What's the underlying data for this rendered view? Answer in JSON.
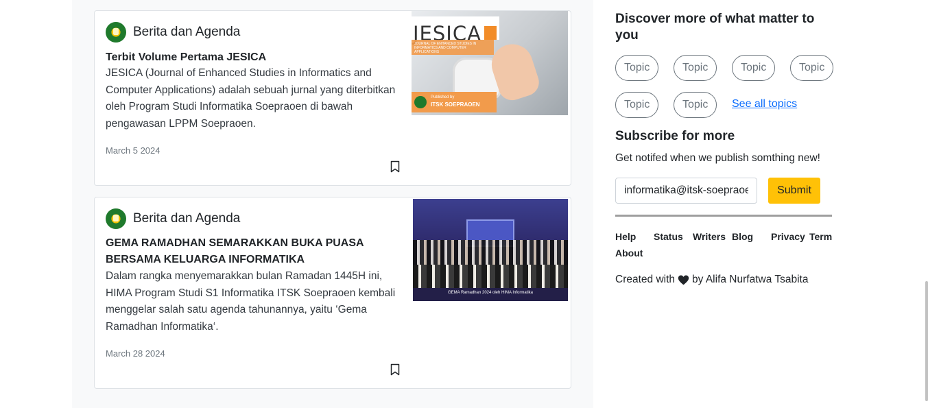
{
  "posts": [
    {
      "category": "Berita dan Agenda",
      "title": "Terbit Volume Pertama JESICA",
      "excerpt": "JESICA (Journal of Enhanced Studies in Informatics and Computer Applications) adalah sebuah jurnal yang diterbitkan oleh Program Studi Informatika Soepraoen di bawah pengawasan LPPM Soepraoen.",
      "date": "March 5 2024",
      "thumb": {
        "logo_text": "JESICA",
        "sub_text": "JOURNAL OF ENHANCED STUDIES IN INFORMATICS AND COMPUTER APPLICATIONS",
        "published_by": "Published by",
        "publisher": "ITSK SOEPRAOEN"
      }
    },
    {
      "category": "Berita dan Agenda",
      "title": "GEMA RAMADHAN SEMARAKKAN BUKA PUASA BERSAMA KELUARGA INFORMATIKA",
      "excerpt": "Dalam rangka menyemarakkan bulan Ramadan 1445H ini, HIMA Program Studi S1 Informatika ITSK Soepraoen kembali menggelar salah satu agenda tahunannya, yaitu ‘Gema Ramadhan Informatika‘.",
      "date": "March 28 2024",
      "thumb": {
        "caption": "GEMA Ramadhan 2024 oleh HIMA Informatika"
      }
    }
  ],
  "sidebar": {
    "discover_title": "Discover more of what matter to you",
    "topics": [
      "Topic",
      "Topic",
      "Topic",
      "Topic",
      "Topic",
      "Topic"
    ],
    "see_all": "See all topics",
    "subscribe_title": "Subscribe for more",
    "subscribe_desc": "Get notifed when we publish somthing new!",
    "email_value": "informatika@itsk-soepraoen.ac.id",
    "submit_label": "Submit",
    "footer_links": [
      "Help",
      "Status",
      "Writers",
      "Blog",
      "Privacy",
      "Term",
      "About"
    ],
    "created_prefix": "Created with",
    "created_suffix": "by Alifa Nurfatwa Tsabita"
  },
  "colors": {
    "accent_yellow": "#ffc107",
    "link_blue": "#0d6efd",
    "left_bg": "#f8f9fa"
  }
}
